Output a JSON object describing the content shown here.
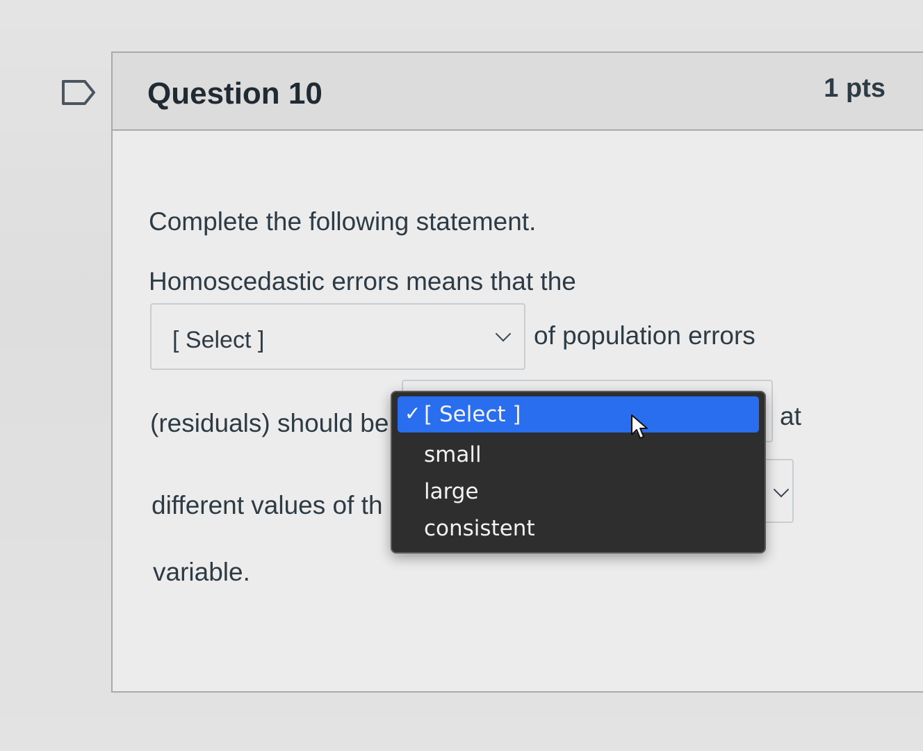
{
  "question": {
    "title": "Question 10",
    "points": "1 pts",
    "prompt": "Complete the following statement.",
    "line1": "Homoscedastic errors means that the",
    "after_select1": "of population errors",
    "line3_prefix": "(residuals) should be",
    "line3_suffix": "at",
    "line4_prefix": "different values of th",
    "line5": "variable."
  },
  "select1": {
    "value": "[ Select ]"
  },
  "dropdown": {
    "options": [
      {
        "label": "[ Select ]",
        "selected": true
      },
      {
        "label": "small",
        "selected": false
      },
      {
        "label": "large",
        "selected": false
      },
      {
        "label": "consistent",
        "selected": false
      }
    ],
    "check_mark": "✓"
  },
  "icons": {
    "flag": "flag-outline-icon",
    "cursor": "mouse-pointer-icon",
    "chevron": "chevron-down-icon"
  },
  "colors": {
    "highlight": "#2a6ef0",
    "menu_bg": "#2e2e2e",
    "text": "#2d3b45"
  }
}
